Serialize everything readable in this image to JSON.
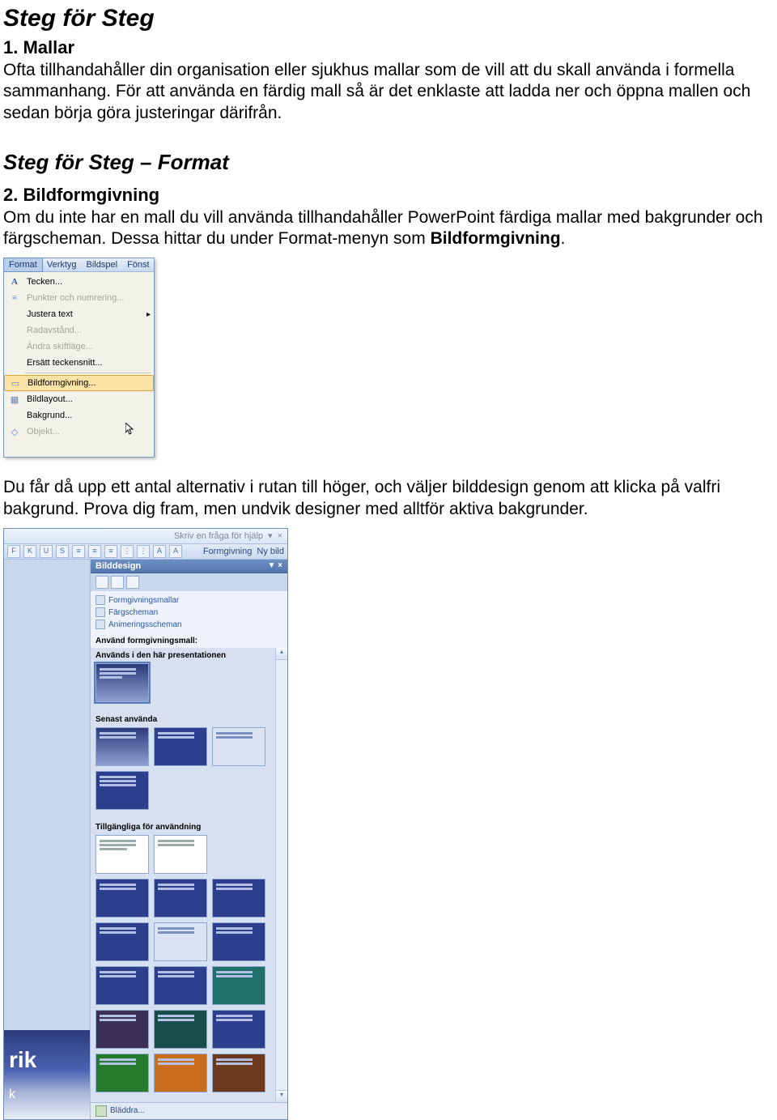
{
  "doc": {
    "title": "Steg för Steg",
    "s1_heading": "1. Mallar",
    "s1_body": "Ofta tillhandahåller din organisation eller sjukhus mallar som de vill att du skall använda i formella sammanhang. För att använda en färdig mall så är det enklaste att ladda ner och öppna mallen och sedan börja göra justeringar därifrån.",
    "section_title": "Steg för Steg – Format",
    "s2_heading": "2. Bildformgivning",
    "s2_body_a": "Om du inte har en mall du vill använda tillhandahåller PowerPoint färdiga mallar med bakgrunder och färgscheman. Dessa hittar du under Format-menyn som ",
    "s2_body_bold": "Bildformgivning",
    "s2_body_b": ".",
    "s2_after": "Du får då upp ett antal alternativ i rutan till höger, och väljer bilddesign genom att klicka på valfri bakgrund. Prova dig fram, men undvik designer med alltför aktiva bakgrunder."
  },
  "dropdown": {
    "menubar": [
      "Format",
      "Verktyg",
      "Bildspel",
      "Fönst"
    ],
    "items": [
      {
        "icon": "A",
        "label": "Tecken...",
        "enabled": true
      },
      {
        "icon": "≡",
        "label": "Punkter och numrering...",
        "enabled": false
      },
      {
        "icon": "",
        "label": "Justera text",
        "enabled": true,
        "arrow": true
      },
      {
        "icon": "",
        "label": "Radavstånd...",
        "enabled": false
      },
      {
        "icon": "",
        "label": "Ändra skiftläge...",
        "enabled": false
      },
      {
        "icon": "",
        "label": "Ersätt teckensnitt...",
        "enabled": true
      },
      {
        "sep": true
      },
      {
        "icon": "▭",
        "label": "Bildformgivning...",
        "enabled": true,
        "highlight": true
      },
      {
        "icon": "▦",
        "label": "Bildlayout...",
        "enabled": true
      },
      {
        "icon": "",
        "label": "Bakgrund...",
        "enabled": true
      },
      {
        "icon": "◇",
        "label": "Objekt...",
        "enabled": false
      }
    ]
  },
  "design_panel": {
    "help_placeholder": "Skriv en fråga för hjälp",
    "toolbar_buttons": [
      "F",
      "K",
      "U",
      "S"
    ],
    "toolbar_text1": "Formgivning",
    "toolbar_text2": "Ny bild",
    "pane_title": "Bilddesign",
    "links": [
      "Formgivningsmallar",
      "Färgscheman",
      "Animeringsscheman"
    ],
    "apply_label": "Använd formgivningsmall:",
    "section_used": "Används i den här presentationen",
    "section_recent": "Senast använda",
    "section_avail": "Tillgängliga för användning",
    "footer": "Bläddra...",
    "slide_preview_title": "rik",
    "slide_preview_sub": "k"
  }
}
